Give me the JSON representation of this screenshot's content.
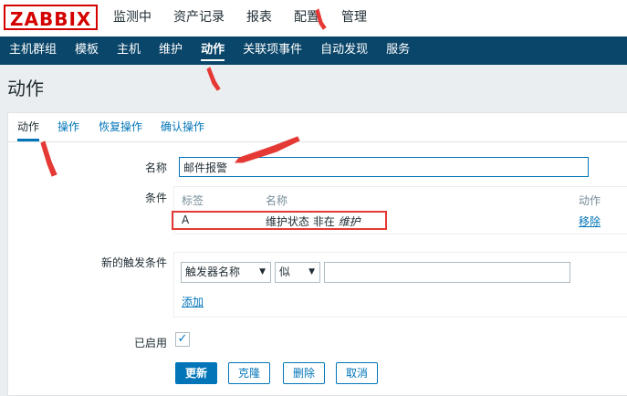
{
  "logo": "ZABBIX",
  "top_nav": [
    {
      "label": "监测中"
    },
    {
      "label": "资产记录"
    },
    {
      "label": "报表"
    },
    {
      "label": "配置"
    },
    {
      "label": "管理"
    }
  ],
  "sub_nav": [
    {
      "label": "主机群组"
    },
    {
      "label": "模板"
    },
    {
      "label": "主机"
    },
    {
      "label": "维护"
    },
    {
      "label": "动作"
    },
    {
      "label": "关联项事件"
    },
    {
      "label": "自动发现"
    },
    {
      "label": "服务"
    }
  ],
  "page_title": "动作",
  "tabs": [
    {
      "label": "动作"
    },
    {
      "label": "操作"
    },
    {
      "label": "恢复操作"
    },
    {
      "label": "确认操作"
    }
  ],
  "form": {
    "name_label": "名称",
    "name_value": "邮件报警",
    "conditions_label": "条件",
    "conditions_headers": {
      "tag": "标签",
      "name": "名称",
      "action": "动作"
    },
    "conditions_rows": [
      {
        "tag": "A",
        "name_prefix": "维护状态 非在 ",
        "name_italic": "维护",
        "action": "移除"
      }
    ],
    "new_condition_label": "新的触发条件",
    "condition_type": "触发器名称",
    "condition_operator": "似",
    "condition_value": "",
    "add_link": "添加",
    "enabled_label": "已启用",
    "enabled": true
  },
  "buttons": {
    "update": "更新",
    "clone": "克隆",
    "delete": "删除",
    "cancel": "取消"
  },
  "colors": {
    "brand": "#d40000",
    "nav_bg": "#0a466a",
    "accent": "#0275b8",
    "annotation": "#e53935"
  }
}
